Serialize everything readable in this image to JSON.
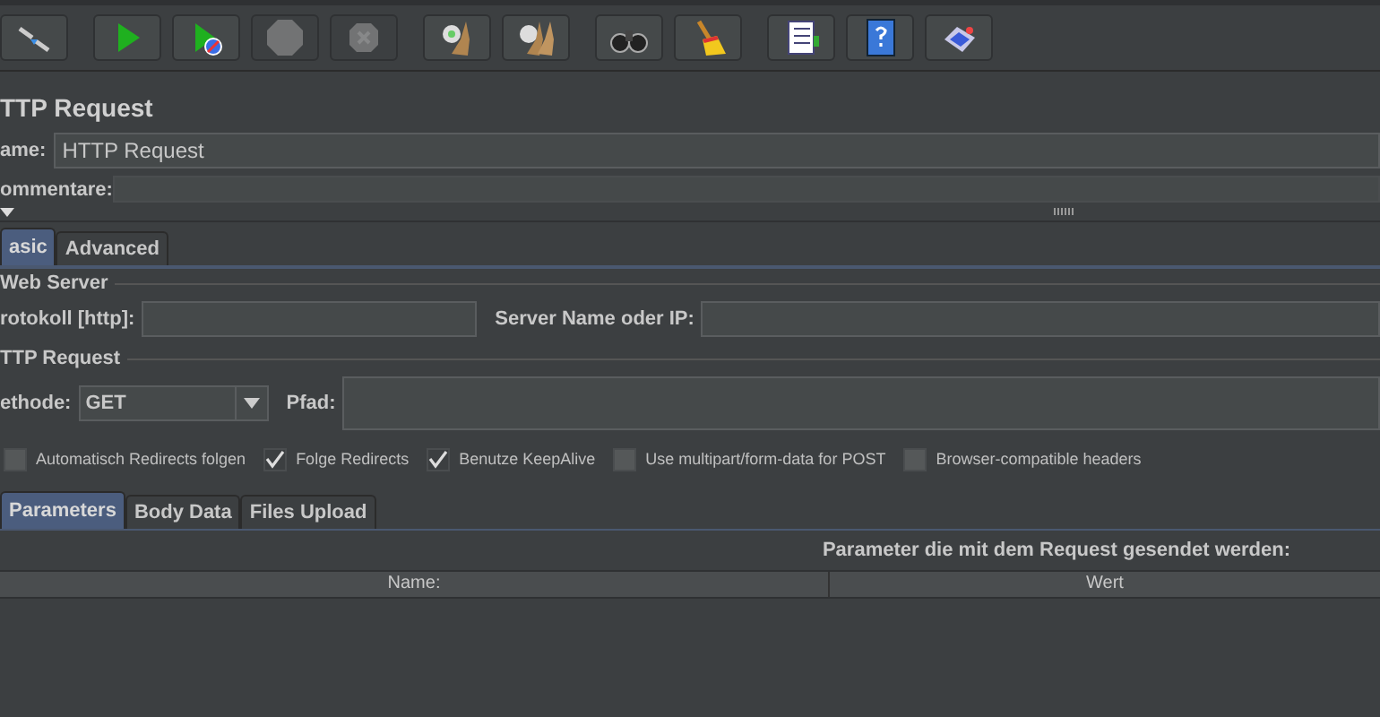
{
  "toolbar": [
    {
      "kind": "templates",
      "disabled": false
    },
    {
      "kind": "start",
      "disabled": false
    },
    {
      "kind": "start-no-pause",
      "disabled": false
    },
    {
      "kind": "stop",
      "disabled": true
    },
    {
      "kind": "shutdown",
      "disabled": true
    },
    {
      "kind": "clear",
      "disabled": false
    },
    {
      "kind": "clear-all",
      "disabled": false
    },
    {
      "kind": "search",
      "disabled": false
    },
    {
      "kind": "reset-search",
      "disabled": false
    },
    {
      "kind": "function-helper",
      "disabled": false
    },
    {
      "kind": "help",
      "disabled": false
    },
    {
      "kind": "remote",
      "disabled": false
    }
  ],
  "title": "TTP Request",
  "name": {
    "label": "ame:",
    "value": "HTTP Request"
  },
  "comment": {
    "label": "ommentare:"
  },
  "tabs": [
    {
      "label": "asic",
      "selected": true
    },
    {
      "label": "Advanced",
      "selected": false
    }
  ],
  "web_server": {
    "legend": "Web Server",
    "protocol_label": "rotokoll [http]:",
    "server_label": "Server Name oder IP:"
  },
  "http_request": {
    "legend": "TTP Request",
    "method_label": "ethode:",
    "method": "GET",
    "path_label": "Pfad:"
  },
  "options": [
    {
      "label": "Automatisch Redirects folgen",
      "checked": false
    },
    {
      "label": "Folge Redirects",
      "checked": true
    },
    {
      "label": "Benutze KeepAlive",
      "checked": true
    },
    {
      "label": "Use multipart/form-data for POST",
      "checked": false
    },
    {
      "label": "Browser-compatible headers",
      "checked": false
    }
  ],
  "sub_tabs": [
    {
      "label": "Parameters",
      "selected": true
    },
    {
      "label": "Body Data",
      "selected": false
    },
    {
      "label": "Files Upload",
      "selected": false
    }
  ],
  "parameters": {
    "caption": "Parameter die mit dem Request gesendet werden:",
    "columns": [
      "Name:",
      "Wert"
    ]
  }
}
